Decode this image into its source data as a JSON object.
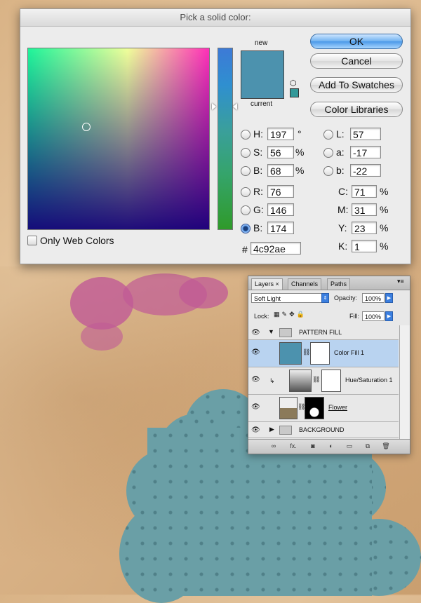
{
  "dialog": {
    "title": "Pick a solid color:",
    "new_label": "new",
    "current_label": "current",
    "current_color": "#4c92ae",
    "buttons": {
      "ok": "OK",
      "cancel": "Cancel",
      "add_to_swatches": "Add To Swatches",
      "color_libraries": "Color Libraries"
    },
    "fields": {
      "H": {
        "label": "H:",
        "value": "197",
        "unit": "°"
      },
      "S": {
        "label": "S:",
        "value": "56",
        "unit": "%"
      },
      "Bh": {
        "label": "B:",
        "value": "68",
        "unit": "%"
      },
      "R": {
        "label": "R:",
        "value": "76"
      },
      "G": {
        "label": "G:",
        "value": "146"
      },
      "B": {
        "label": "B:",
        "value": "174"
      },
      "L": {
        "label": "L:",
        "value": "57"
      },
      "a": {
        "label": "a:",
        "value": "-17"
      },
      "b": {
        "label": "b:",
        "value": "-22"
      },
      "C": {
        "label": "C:",
        "value": "71",
        "unit": "%"
      },
      "M": {
        "label": "M:",
        "value": "31",
        "unit": "%"
      },
      "Y": {
        "label": "Y:",
        "value": "23",
        "unit": "%"
      },
      "K": {
        "label": "K:",
        "value": "1",
        "unit": "%"
      }
    },
    "hex_label": "#",
    "hex_value": "4c92ae",
    "only_web_colors": "Only Web Colors",
    "selected_channel": "B",
    "icons": {
      "cube": "cube-icon"
    }
  },
  "layers_panel": {
    "tabs": [
      "Layers",
      "Channels",
      "Paths"
    ],
    "tab_close": "×",
    "blend_mode": "Soft Light",
    "opacity_label": "Opacity:",
    "opacity_value": "100%",
    "lock_label": "Lock:",
    "fill_label": "Fill:",
    "fill_value": "100%",
    "layers": [
      {
        "name": "PATTERN FILL",
        "type": "group",
        "expanded": true
      },
      {
        "name": "Color Fill 1",
        "type": "fill",
        "selected": true
      },
      {
        "name": "Hue/Saturation 1",
        "type": "adjustment"
      },
      {
        "name": "Flower",
        "type": "pixel"
      },
      {
        "name": "BACKGROUND",
        "type": "group",
        "expanded": false
      }
    ],
    "bottom_icons": [
      "link-icon",
      "fx-icon",
      "mask-icon",
      "adjustment-icon",
      "folder-icon",
      "new-layer-icon",
      "trash-icon"
    ],
    "fx_label": "fx."
  }
}
